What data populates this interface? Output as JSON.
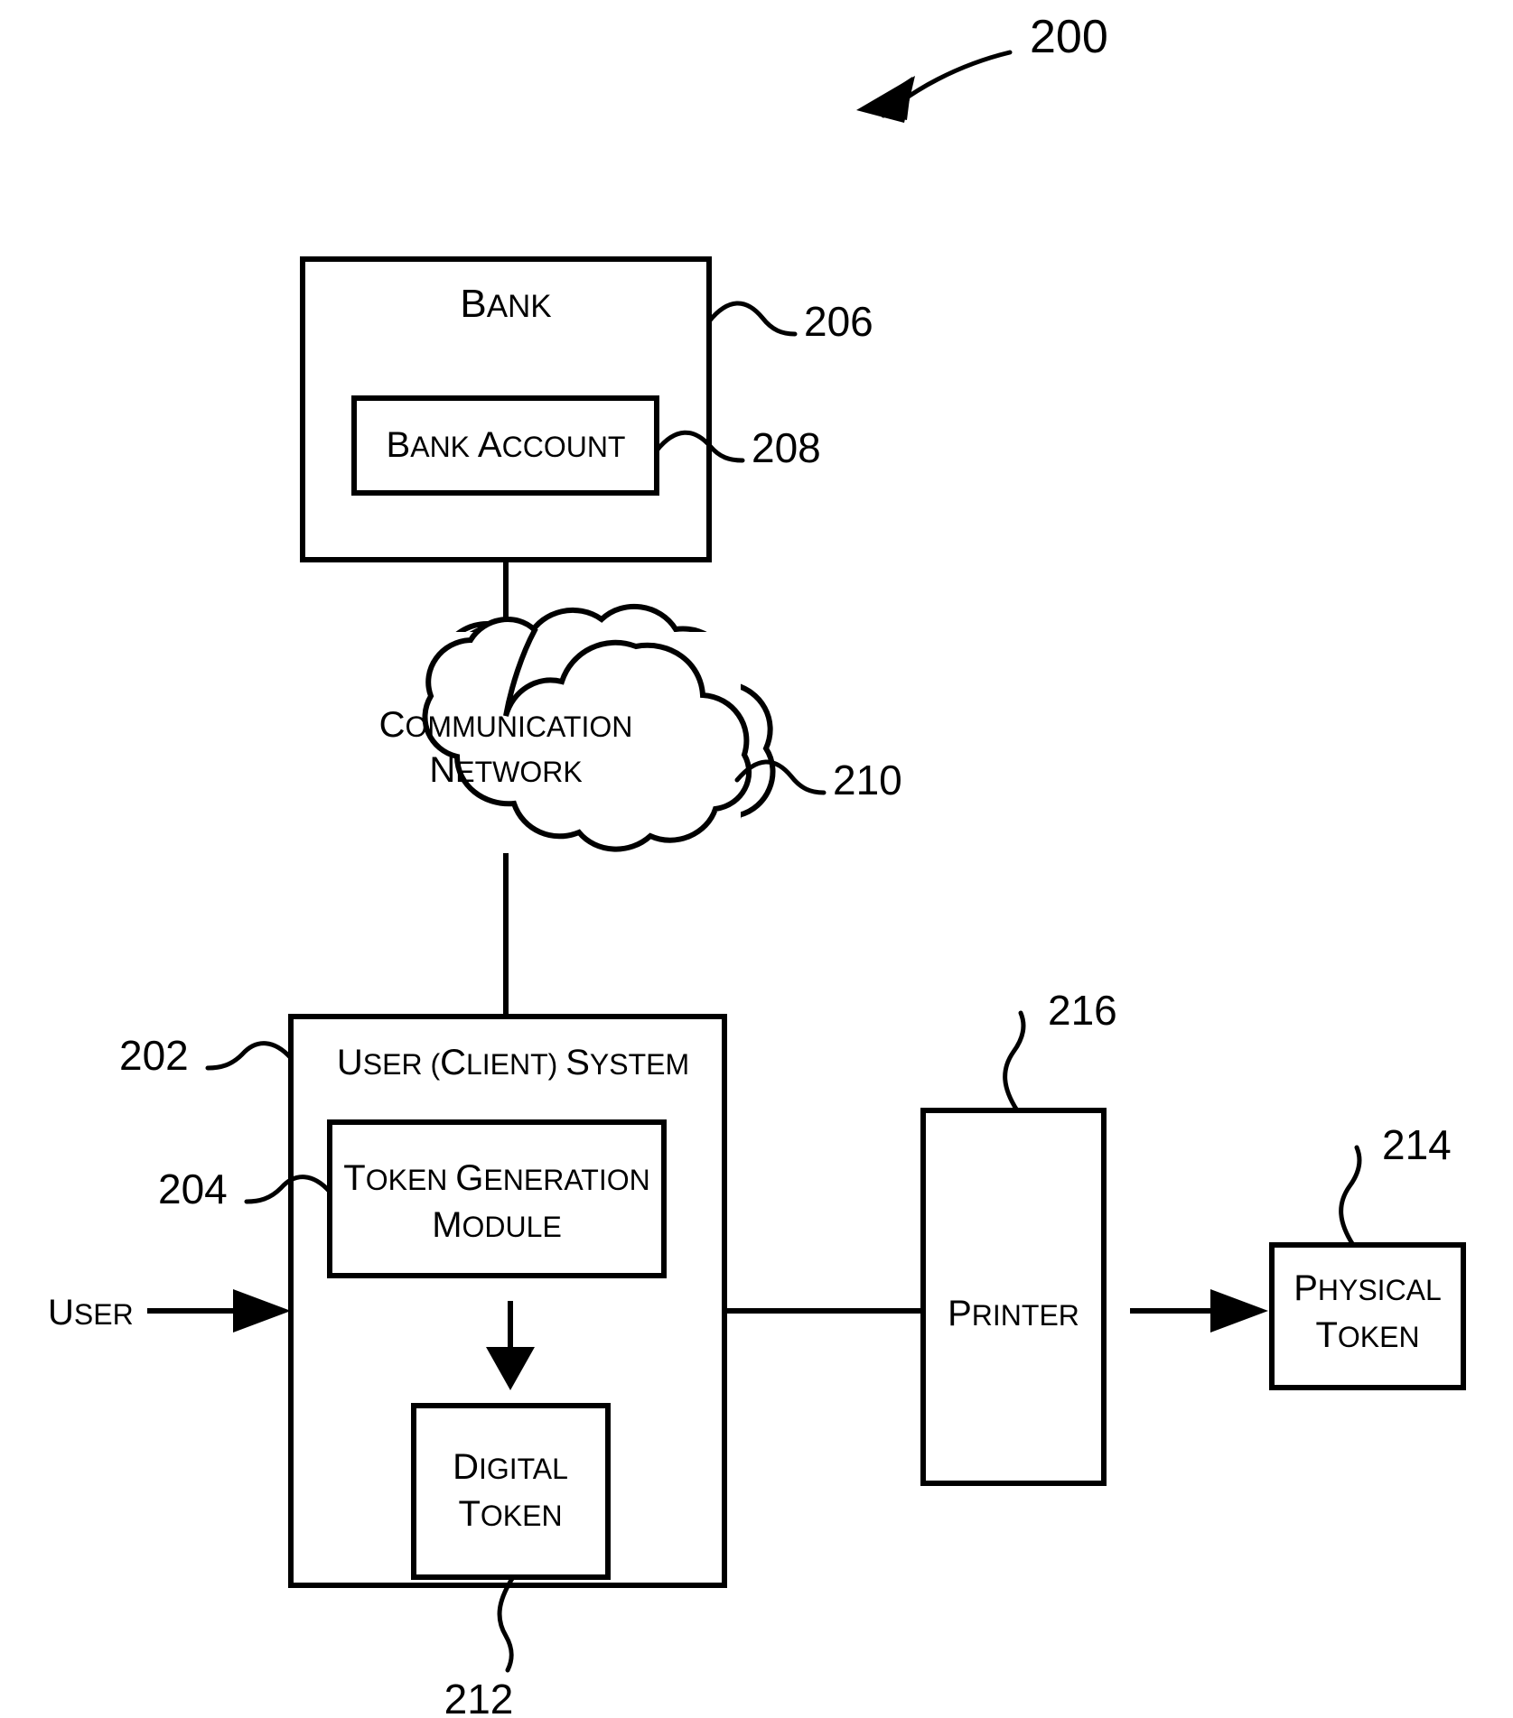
{
  "figure": {
    "number": "200",
    "type": "patent-block-diagram"
  },
  "nodes": {
    "bank": {
      "label_lead": "B",
      "label_rest": "ANK",
      "ref": "206"
    },
    "bank_account": {
      "word1_lead": "B",
      "word1_rest": "ANK",
      "word2_lead": "A",
      "word2_rest": "CCOUNT",
      "ref": "208"
    },
    "network": {
      "line1_lead": "C",
      "line1_rest": "OMMUNICATION",
      "line2_lead": "N",
      "line2_rest": "ETWORK",
      "ref": "210"
    },
    "user_system": {
      "seg1_lead": "U",
      "seg1_rest": "SER (",
      "seg2_lead": "C",
      "seg2_rest": "LIENT) ",
      "seg3_lead": "S",
      "seg3_rest": "YSTEM",
      "ref": "202"
    },
    "token_generation_module": {
      "line1_lead": "T",
      "line1_rest": "OKEN ",
      "line1_lead2": "G",
      "line1_rest2": "ENERATION",
      "line2_lead": "M",
      "line2_rest": "ODULE",
      "ref": "204"
    },
    "digital_token": {
      "line1_lead": "D",
      "line1_rest": "IGITAL",
      "line2_lead": "T",
      "line2_rest": "OKEN",
      "ref": "212"
    },
    "printer": {
      "label_lead": "P",
      "label_rest": "RINTER",
      "ref": "216"
    },
    "physical_token": {
      "line1_lead": "P",
      "line1_rest": "HYSICAL",
      "line2_lead": "T",
      "line2_rest": "OKEN",
      "ref": "214"
    },
    "user_actor": {
      "label_lead": "U",
      "label_rest": "SER"
    }
  },
  "colors": {
    "ink": "#000000",
    "paper": "#ffffff"
  }
}
